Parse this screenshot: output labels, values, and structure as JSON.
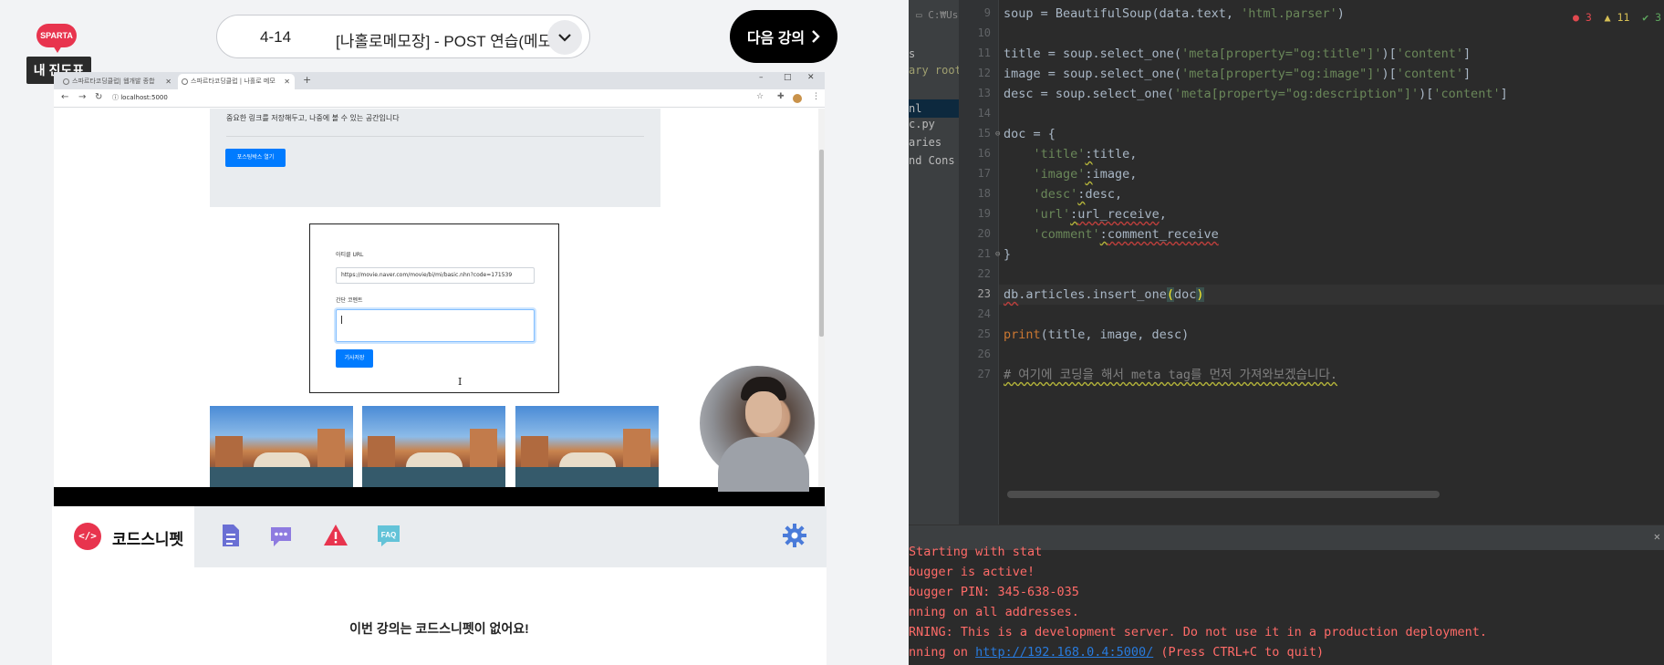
{
  "player": {
    "logo_text": "SPARTA",
    "progress_tooltip": "내 진도표",
    "lecture_number": "4-14",
    "lecture_title": "[나홀로메모장] - POST 연습(메모하기)",
    "next_button": "다음 강의",
    "chevron_icon": "chevron-down-icon",
    "browser": {
      "tab1_title": "스파르타코딩클럽| 웹개발 종합",
      "tab2_title": "스파르타코딩클럽 | 나홀로 메모",
      "new_tab": "+",
      "minimize": "–",
      "maximize": "□",
      "close": "✕",
      "address": "localhost:5000"
    },
    "page": {
      "jumbo_desc": "중요한 링크를 저장해두고, 나중에 볼 수 있는 공간입니다",
      "jumbo_button": "포스팅박스 열기",
      "url_label": "아티클 URL",
      "url_value": "https://movie.naver.com/movie/bi/mi/basic.nhn?code=171539",
      "comment_label": "간단 코멘트",
      "save_button": "기사저장"
    },
    "snippet": {
      "tab_label": "코드스니펫",
      "tab_icon_text": "</>",
      "empty_message": "이번 강의는 코드스니펫이 없어요!"
    }
  },
  "ide": {
    "path_fragment": "C:₩Us",
    "project_items": [
      "s",
      "ary root",
      "",
      "nl",
      "c.py",
      "aries",
      "nd Cons"
    ],
    "inspections": {
      "errors": "3",
      "warnings": "11",
      "ok": "3"
    },
    "line_numbers": [
      "9",
      "10",
      "11",
      "12",
      "13",
      "14",
      "15",
      "16",
      "17",
      "18",
      "19",
      "20",
      "21",
      "22",
      "23",
      "24",
      "25",
      "26",
      "27"
    ],
    "current_line": "23",
    "console_lines": [
      "Starting with stat",
      "bugger is active!",
      "bugger PIN: 345-638-035",
      "nning on all addresses.",
      "RNING: This is a development server. Do not use it in a production deployment.",
      "nning on ",
      "http://192.168.0.4:5000/",
      " (Press CTRL+C to quit)"
    ]
  },
  "colors": {
    "brand_red": "#e8344e",
    "ide_bg": "#2b2b2b",
    "keyword": "#cc7832",
    "string": "#6a8759",
    "console_red": "#ff6b68",
    "bootstrap_blue": "#007bff"
  }
}
